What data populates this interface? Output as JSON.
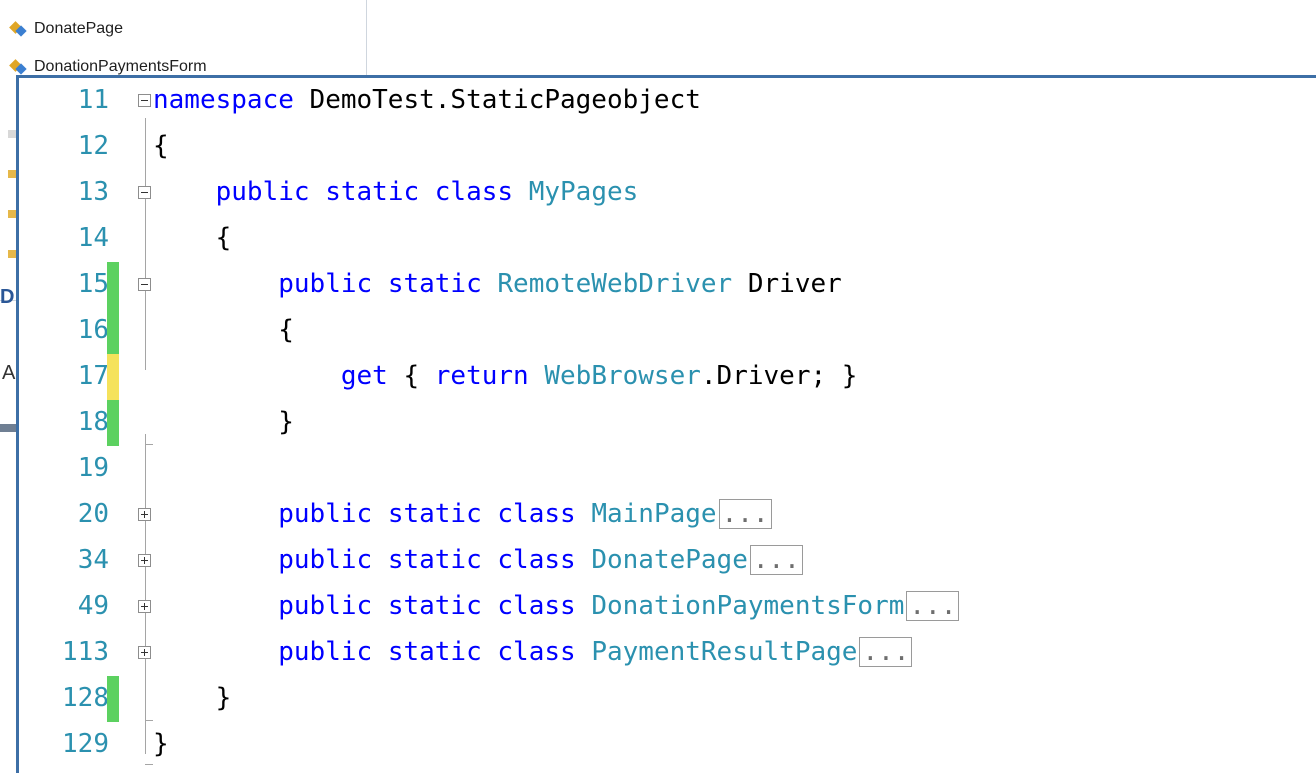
{
  "solution_explorer": {
    "items": [
      {
        "label": "DonatePage",
        "icon": "class-icon"
      },
      {
        "label": "DonationPaymentsForm",
        "icon": "class-icon"
      }
    ],
    "partial_link": "D",
    "partial_text": "A"
  },
  "editor": {
    "lines": [
      {
        "num": "11",
        "change": "none",
        "fold": "minus",
        "tokens": [
          {
            "t": "namespace",
            "c": "kw"
          },
          {
            "t": " DemoTest.StaticPageobject",
            "c": "pl"
          }
        ]
      },
      {
        "num": "12",
        "change": "none",
        "fold": "none",
        "tokens": [
          {
            "t": "{",
            "c": "pl"
          }
        ]
      },
      {
        "num": "13",
        "change": "none",
        "fold": "minus",
        "tokens": [
          {
            "t": "    ",
            "c": "pl"
          },
          {
            "t": "public",
            "c": "kw"
          },
          {
            "t": " ",
            "c": "pl"
          },
          {
            "t": "static",
            "c": "kw"
          },
          {
            "t": " ",
            "c": "pl"
          },
          {
            "t": "class",
            "c": "kw"
          },
          {
            "t": " ",
            "c": "pl"
          },
          {
            "t": "MyPages",
            "c": "ty"
          }
        ]
      },
      {
        "num": "14",
        "change": "none",
        "fold": "none",
        "tokens": [
          {
            "t": "    {",
            "c": "pl"
          }
        ]
      },
      {
        "num": "15",
        "change": "saved",
        "fold": "minus",
        "tokens": [
          {
            "t": "        ",
            "c": "pl"
          },
          {
            "t": "public",
            "c": "kw"
          },
          {
            "t": " ",
            "c": "pl"
          },
          {
            "t": "static",
            "c": "kw"
          },
          {
            "t": " ",
            "c": "pl"
          },
          {
            "t": "RemoteWebDriver",
            "c": "ty"
          },
          {
            "t": " Driver",
            "c": "pl"
          }
        ]
      },
      {
        "num": "16",
        "change": "saved",
        "fold": "none",
        "tokens": [
          {
            "t": "        {",
            "c": "pl"
          }
        ]
      },
      {
        "num": "17",
        "change": "unsaved",
        "fold": "none",
        "tokens": [
          {
            "t": "            ",
            "c": "pl"
          },
          {
            "t": "get",
            "c": "kw"
          },
          {
            "t": " { ",
            "c": "pl"
          },
          {
            "t": "return",
            "c": "kw"
          },
          {
            "t": " ",
            "c": "pl"
          },
          {
            "t": "WebBrowser",
            "c": "ty"
          },
          {
            "t": ".Driver; }",
            "c": "pl"
          }
        ]
      },
      {
        "num": "18",
        "change": "saved",
        "fold": "none",
        "tokens": [
          {
            "t": "        }",
            "c": "pl"
          }
        ]
      },
      {
        "num": "19",
        "change": "none",
        "fold": "none",
        "tokens": []
      },
      {
        "num": "20",
        "change": "none",
        "fold": "plus",
        "tokens": [
          {
            "t": "        ",
            "c": "pl"
          },
          {
            "t": "public",
            "c": "kw"
          },
          {
            "t": " ",
            "c": "pl"
          },
          {
            "t": "static",
            "c": "kw"
          },
          {
            "t": " ",
            "c": "pl"
          },
          {
            "t": "class",
            "c": "kw"
          },
          {
            "t": " ",
            "c": "pl"
          },
          {
            "t": "MainPage",
            "c": "ty"
          },
          {
            "t": "...",
            "c": "collapsed"
          }
        ]
      },
      {
        "num": "34",
        "change": "none",
        "fold": "plus",
        "tokens": [
          {
            "t": "        ",
            "c": "pl"
          },
          {
            "t": "public",
            "c": "kw"
          },
          {
            "t": " ",
            "c": "pl"
          },
          {
            "t": "static",
            "c": "kw"
          },
          {
            "t": " ",
            "c": "pl"
          },
          {
            "t": "class",
            "c": "kw"
          },
          {
            "t": " ",
            "c": "pl"
          },
          {
            "t": "DonatePage",
            "c": "ty"
          },
          {
            "t": "...",
            "c": "collapsed"
          }
        ]
      },
      {
        "num": "49",
        "change": "none",
        "fold": "plus",
        "tokens": [
          {
            "t": "        ",
            "c": "pl"
          },
          {
            "t": "public",
            "c": "kw"
          },
          {
            "t": " ",
            "c": "pl"
          },
          {
            "t": "static",
            "c": "kw"
          },
          {
            "t": " ",
            "c": "pl"
          },
          {
            "t": "class",
            "c": "kw"
          },
          {
            "t": " ",
            "c": "pl"
          },
          {
            "t": "DonationPaymentsForm",
            "c": "ty"
          },
          {
            "t": "...",
            "c": "collapsed"
          }
        ]
      },
      {
        "num": "113",
        "change": "none",
        "fold": "plus",
        "tokens": [
          {
            "t": "        ",
            "c": "pl"
          },
          {
            "t": "public",
            "c": "kw"
          },
          {
            "t": " ",
            "c": "pl"
          },
          {
            "t": "static",
            "c": "kw"
          },
          {
            "t": " ",
            "c": "pl"
          },
          {
            "t": "class",
            "c": "kw"
          },
          {
            "t": " ",
            "c": "pl"
          },
          {
            "t": "PaymentResultPage",
            "c": "ty"
          },
          {
            "t": "...",
            "c": "collapsed"
          }
        ]
      },
      {
        "num": "128",
        "change": "saved",
        "fold": "none",
        "tokens": [
          {
            "t": "    }",
            "c": "pl"
          }
        ]
      },
      {
        "num": "129",
        "change": "none",
        "fold": "none",
        "tokens": [
          {
            "t": "}",
            "c": "pl"
          }
        ]
      }
    ]
  },
  "colors": {
    "keyword": "#0000ff",
    "type": "#2b91af",
    "line_number": "#2b91af",
    "saved_change": "#5cd160",
    "unsaved_change": "#f5e25b",
    "window_border": "#3d6fa6"
  }
}
